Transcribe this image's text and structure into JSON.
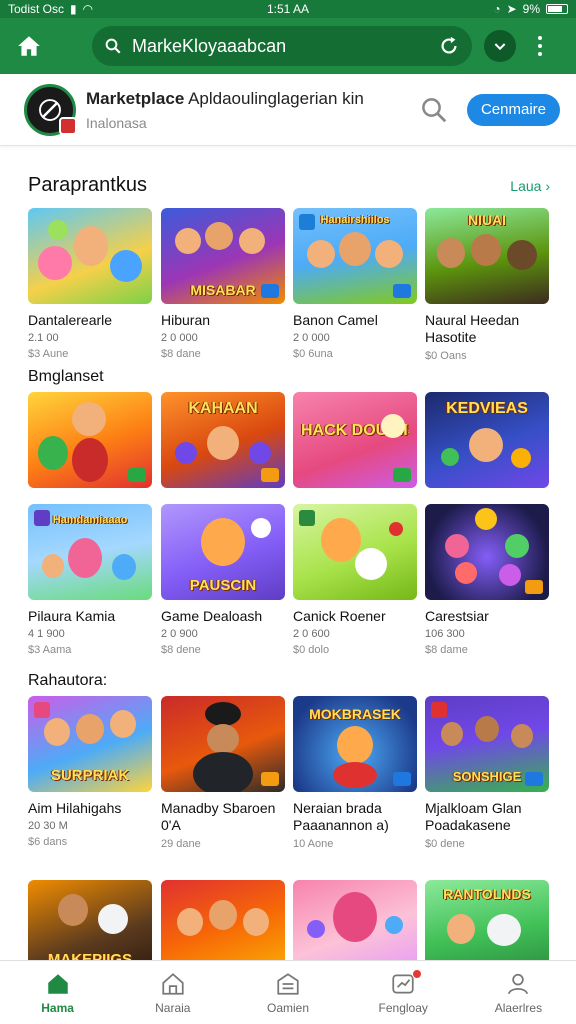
{
  "status_bar": {
    "left": "Todist Osc",
    "time": "1:51 AA",
    "battery": "9%"
  },
  "browser": {
    "url": "MarkeKloyaaabcan"
  },
  "header": {
    "title_bold": "Marketplace",
    "title_rest": "Apldaoulinglagerian kin",
    "subtitle": "Inalonasa",
    "compare_label": "Cenmaire"
  },
  "sections": [
    {
      "title": "Paraprantkus",
      "see_all": "Laua ›"
    },
    {
      "title": "Bmglanset"
    },
    {
      "title": "Rahautora:"
    }
  ],
  "games": [
    {
      "name": "Dantalerearle",
      "meta": "2.1 00",
      "meta2": "$3 Aune"
    },
    {
      "name": "Hiburan",
      "meta": "2 0 000",
      "meta2": "$8 dane"
    },
    {
      "name": "Banon Camel",
      "meta": "2 0 000",
      "meta2": "$0 6una"
    },
    {
      "name": "Naural Heedan Hasotite",
      "meta": "",
      "meta2": "$0 Oans"
    },
    {
      "name": "",
      "meta": "",
      "meta2": "",
      "banner": ""
    },
    {
      "name": "",
      "meta": "",
      "meta2": "",
      "banner": "KAHAAN"
    },
    {
      "name": "",
      "meta": "",
      "meta2": "",
      "banner": "HACK DOUAIIS"
    },
    {
      "name": "",
      "meta": "",
      "meta2": "",
      "banner": "KEDVIEAS"
    },
    {
      "name": "Pilaura Kamia",
      "meta": "4 1 900",
      "meta2": "$3 Aama",
      "banner": ""
    },
    {
      "name": "Game Dealoash",
      "meta": "2 0 900",
      "meta2": "$8 dene",
      "banner": "PAUSCIN"
    },
    {
      "name": "Canick Roener",
      "meta": "2 0 600",
      "meta2": "$0 dolo",
      "banner": ""
    },
    {
      "name": "Carestsiar",
      "meta": "106 300",
      "meta2": "$8 dame",
      "banner": ""
    },
    {
      "name": "Aim Hilahigahs",
      "meta": "20 30 M",
      "meta2": "$6 dans",
      "banner": "SURPRIAK"
    },
    {
      "name": "Manadby Sbaroen 0'A",
      "meta": "",
      "meta2": "29 dane",
      "banner": ""
    },
    {
      "name": "Neraian brada Paaanannon a)",
      "meta": "",
      "meta2": "10 Aone",
      "banner": "MOKBRASEK"
    },
    {
      "name": "Mjalkloam Glan Poadakasene",
      "meta": "",
      "meta2": "$0 dene",
      "banner": "SONSHIGE"
    },
    {
      "name": "",
      "meta": "",
      "meta2": "",
      "banner": "MAKEPIIGS"
    },
    {
      "name": "",
      "meta": "",
      "meta2": "",
      "banner": ""
    },
    {
      "name": "",
      "meta": "",
      "meta2": "",
      "banner": ""
    },
    {
      "name": "",
      "meta": "",
      "meta2": "",
      "banner": "RANTOLNDS"
    }
  ],
  "nav": [
    "Hama",
    "Naraia",
    "Oamien",
    "Fengloay",
    "Alaerlres"
  ],
  "colors": {
    "primary_green": "#1f8a43",
    "accent_blue": "#1e88e5"
  }
}
